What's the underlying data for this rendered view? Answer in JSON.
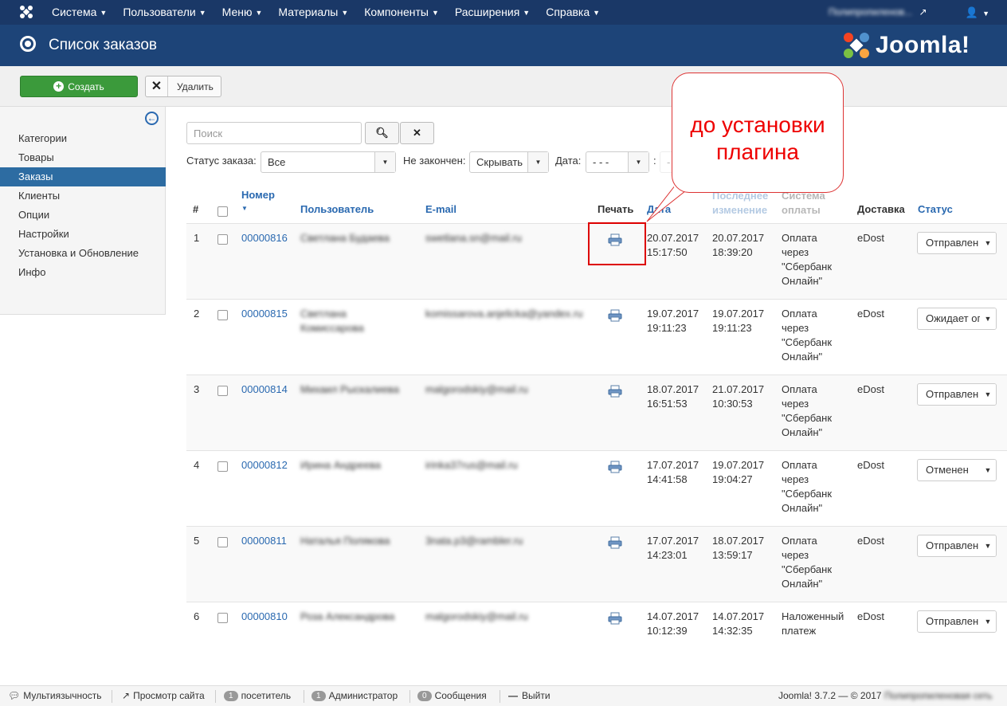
{
  "topbar": {
    "menu": [
      "Система",
      "Пользователи",
      "Меню",
      "Материалы",
      "Компоненты",
      "Расширения",
      "Справка"
    ],
    "site_name": "Полипропиленов..."
  },
  "header": {
    "title": "Список заказов",
    "logo_text": "Joomla!"
  },
  "toolbar": {
    "create_label": "Создать",
    "delete_label": "Удалить"
  },
  "sidebar": {
    "items": [
      "Категории",
      "Товары",
      "Заказы",
      "Клиенты",
      "Опции",
      "Настройки",
      "Установка и Обновление",
      "Инфо"
    ],
    "active_index": 2
  },
  "filters": {
    "search_placeholder": "Поиск",
    "status_label": "Статус заказа:",
    "status_value": "Все",
    "unfinished_label": "Не закончен:",
    "unfinished_value": "Скрывать",
    "date_label": "Дата:",
    "date_from": "- - -",
    "date_to": "- - -"
  },
  "table": {
    "headers": {
      "num": "#",
      "number": "Номер",
      "user": "Пользователь",
      "email": "E-mail",
      "print": "Печать",
      "date": "Дата",
      "modified_1": "Последнее",
      "modified_2": "изменение",
      "payment_1": "Система",
      "payment_2": "оплаты",
      "delivery": "Доставка",
      "status": "Статус"
    },
    "rows": [
      {
        "n": "1",
        "number": "00000816",
        "user_1": "Светлана Будаева",
        "user_2": "",
        "email": "swetlana.sn@mail.ru",
        "date": "20.07.2017",
        "time": "15:17:50",
        "mod_date": "20.07.2017",
        "mod_time": "18:39:20",
        "pay": [
          "Оплата",
          "через",
          "\"Сбербанк",
          "Онлайн\""
        ],
        "delivery": "eDost",
        "status": "Отправлен"
      },
      {
        "n": "2",
        "number": "00000815",
        "user_1": "Светлана",
        "user_2": "Комиссарова",
        "email": "komissarova.anjelicka@yandex.ru",
        "date": "19.07.2017",
        "time": "19:11:23",
        "mod_date": "19.07.2017",
        "mod_time": "19:11:23",
        "pay": [
          "Оплата",
          "через",
          "\"Сбербанк",
          "Онлайн\""
        ],
        "delivery": "eDost",
        "status": "Ожидает оплаты"
      },
      {
        "n": "3",
        "number": "00000814",
        "user_1": "Михаил Рыскалиева",
        "user_2": "",
        "email": "malgorodskiy@mail.ru",
        "date": "18.07.2017",
        "time": "16:51:53",
        "mod_date": "21.07.2017",
        "mod_time": "10:30:53",
        "pay": [
          "Оплата",
          "через",
          "\"Сбербанк",
          "Онлайн\""
        ],
        "delivery": "eDost",
        "status": "Отправлен"
      },
      {
        "n": "4",
        "number": "00000812",
        "user_1": "Ирина Андреева",
        "user_2": "",
        "email": "irinka37rus@mail.ru",
        "date": "17.07.2017",
        "time": "14:41:58",
        "mod_date": "19.07.2017",
        "mod_time": "19:04:27",
        "pay": [
          "Оплата",
          "через",
          "\"Сбербанк",
          "Онлайн\""
        ],
        "delivery": "eDost",
        "status": "Отменен"
      },
      {
        "n": "5",
        "number": "00000811",
        "user_1": "Наталья Полякова",
        "user_2": "",
        "email": "3nata.p3@rambler.ru",
        "date": "17.07.2017",
        "time": "14:23:01",
        "mod_date": "18.07.2017",
        "mod_time": "13:59:17",
        "pay": [
          "Оплата",
          "через",
          "\"Сбербанк",
          "Онлайн\""
        ],
        "delivery": "eDost",
        "status": "Отправлен"
      },
      {
        "n": "6",
        "number": "00000810",
        "user_1": "Роза Александрова",
        "user_2": "",
        "email": "malgorodskiy@mail.ru",
        "date": "14.07.2017",
        "time": "10:12:39",
        "mod_date": "14.07.2017",
        "mod_time": "14:32:35",
        "pay": [
          "Наложенный",
          "платеж"
        ],
        "delivery": "eDost",
        "status": "Отправлен"
      }
    ]
  },
  "annotation": {
    "line1": "до установки",
    "line2": "плагина"
  },
  "footer": {
    "multilang": "Мультиязычность",
    "view_site": "Просмотр сайта",
    "visitors_count": "1",
    "visitors_label": "посетитель",
    "admins_count": "1",
    "admins_label": "Администратор",
    "messages_count": "0",
    "messages_label": "Сообщения",
    "logout": "Выйти",
    "version": "Joomla! 3.7.2",
    "copyright": "— © 2017",
    "company": "Полипропиленовая сеть"
  },
  "colors": {
    "topbar": "#1a3867",
    "header": "#1d4478",
    "create_button": "#3b9a3b",
    "sidebar_active": "#2d6ca2",
    "link": "#2a69b0",
    "annotation": "#dd0000"
  }
}
